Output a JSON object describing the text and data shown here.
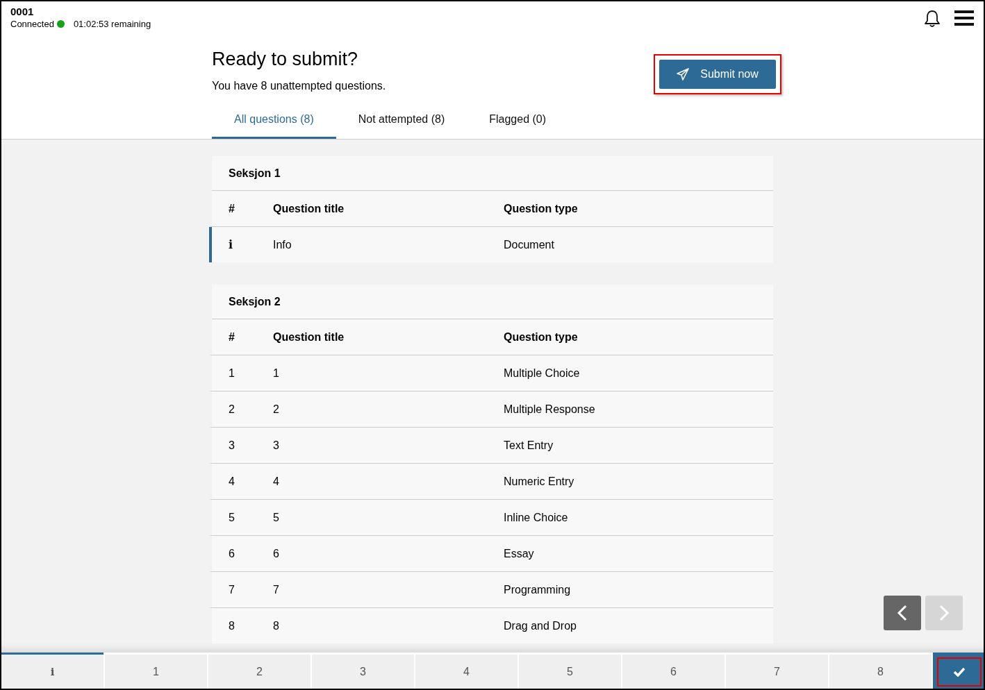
{
  "header": {
    "candidate": "0001",
    "connection": "Connected",
    "connected": true,
    "time_remaining": "01:02:53 remaining"
  },
  "submit_panel": {
    "title": "Ready to submit?",
    "message": "You have 8 unattempted questions.",
    "button": "Submit now",
    "highlighted": true
  },
  "tabs": [
    {
      "label": "All questions (8)",
      "selected": true
    },
    {
      "label": "Not attempted (8)",
      "selected": false
    },
    {
      "label": "Flagged (0)",
      "selected": false
    }
  ],
  "sections": [
    {
      "title": "Seksjon 1",
      "columns": [
        "#",
        "Question title",
        "Question type"
      ],
      "rows": [
        {
          "number": "i",
          "kind": "info",
          "title": "Info",
          "type": "Document",
          "current": true
        }
      ]
    },
    {
      "title": "Seksjon 2",
      "columns": [
        "#",
        "Question title",
        "Question type"
      ],
      "rows": [
        {
          "number": "1",
          "kind": "question",
          "title": "1",
          "type": "Multiple Choice",
          "current": false
        },
        {
          "number": "2",
          "kind": "question",
          "title": "2",
          "type": "Multiple Response",
          "current": false
        },
        {
          "number": "3",
          "kind": "question",
          "title": "3",
          "type": "Text Entry",
          "current": false
        },
        {
          "number": "4",
          "kind": "question",
          "title": "4",
          "type": "Numeric Entry",
          "current": false
        },
        {
          "number": "5",
          "kind": "question",
          "title": "5",
          "type": "Inline Choice",
          "current": false
        },
        {
          "number": "6",
          "kind": "question",
          "title": "6",
          "type": "Essay",
          "current": false
        },
        {
          "number": "7",
          "kind": "question",
          "title": "7",
          "type": "Programming",
          "current": false
        },
        {
          "number": "8",
          "kind": "question",
          "title": "8",
          "type": "Drag and Drop",
          "current": false
        }
      ]
    }
  ],
  "pager": {
    "previous_disabled": false,
    "next_disabled": true
  },
  "footer": [
    {
      "kind": "info",
      "label": "i",
      "current": true,
      "selected": false
    },
    {
      "kind": "question",
      "label": "1",
      "current": false,
      "selected": false
    },
    {
      "kind": "question",
      "label": "2",
      "current": false,
      "selected": false
    },
    {
      "kind": "question",
      "label": "3",
      "current": false,
      "selected": false
    },
    {
      "kind": "question",
      "label": "4",
      "current": false,
      "selected": false
    },
    {
      "kind": "question",
      "label": "5",
      "current": false,
      "selected": false
    },
    {
      "kind": "question",
      "label": "6",
      "current": false,
      "selected": false
    },
    {
      "kind": "question",
      "label": "7",
      "current": false,
      "selected": false
    },
    {
      "kind": "question",
      "label": "8",
      "current": false,
      "selected": false
    },
    {
      "kind": "submit",
      "current": false,
      "selected": true,
      "highlighted": true
    }
  ]
}
